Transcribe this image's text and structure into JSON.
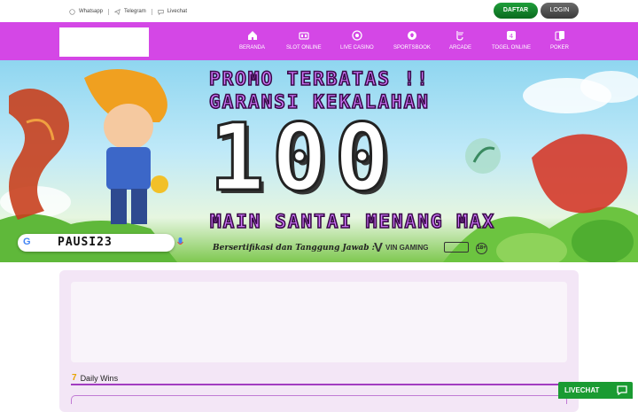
{
  "topbar": {
    "contacts": [
      {
        "label": "Whatsapp",
        "icon": "whatsapp-icon"
      },
      {
        "label": "Telegram",
        "icon": "telegram-icon"
      },
      {
        "label": "Livechat",
        "icon": "chat-bubble-icon"
      }
    ],
    "daftar_label": "DAFTAR",
    "login_label": "LOGIN"
  },
  "nav": {
    "items": [
      {
        "label": "BERANDA",
        "icon": "home-icon"
      },
      {
        "label": "SLOT ONLINE",
        "icon": "slot-machine-icon"
      },
      {
        "label": "LIVE CASINO",
        "icon": "casino-chip-icon"
      },
      {
        "label": "SPORTSBOOK",
        "icon": "soccer-ball-icon"
      },
      {
        "label": "ARCADE",
        "icon": "fishing-icon"
      },
      {
        "label": "TOGEL ONLINE",
        "icon": "lottery-icon"
      },
      {
        "label": "POKER",
        "icon": "poker-cards-icon"
      }
    ]
  },
  "banner": {
    "line1": "PROMO TERBATAS !!",
    "line2": "GARANSI KEKALAHAN",
    "big_number": "100",
    "line3": "MAIN SANTAI MENANG MAX",
    "certified": "Bersertifikasi dan Tanggung Jawab :",
    "vin_gaming": "VIN GAMING",
    "age": "18+",
    "search_text": "PAUSI23"
  },
  "content": {
    "daily_wins_label": "Daily Wins",
    "daily_wins_icon": "7"
  },
  "livechat_label": "LIVECHAT",
  "colors": {
    "nav_bg": "#d447e6",
    "daftar_bg": "#128a2c",
    "login_bg": "#4a4a4a",
    "livechat_bg": "#1a9b32",
    "accent_purple": "#a23cc0"
  }
}
